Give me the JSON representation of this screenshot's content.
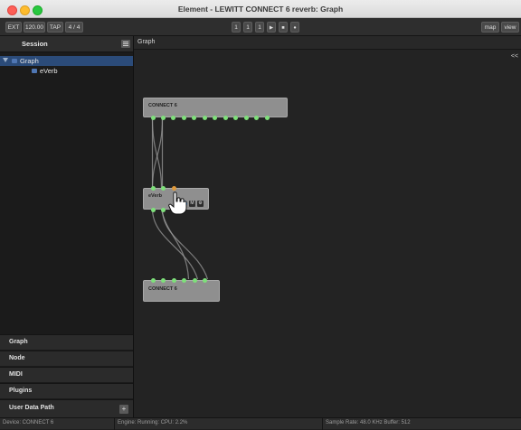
{
  "window": {
    "title": "Element - LEWITT CONNECT 6 reverb: Graph"
  },
  "toolbar": {
    "ext": "EXT",
    "tempo": "120.00",
    "tap": "TAP",
    "meter": "4 / 4",
    "transport": [
      "1",
      "1",
      "1",
      "▶",
      "■",
      "●"
    ],
    "map": "map",
    "view": "view"
  },
  "sidebar": {
    "session_title": "Session",
    "tree": [
      {
        "label": "Graph",
        "selected": true
      },
      {
        "label": "eVerb",
        "selected": false
      }
    ],
    "sections": [
      "Graph",
      "Node",
      "MIDI",
      "Plugins",
      "User Data Path"
    ],
    "add_symbol": "+"
  },
  "main": {
    "tab": "Graph",
    "toggle": "<<"
  },
  "graph": {
    "nodes": [
      {
        "name": "CONNECT 6",
        "outputs": 12,
        "inputs": 0
      },
      {
        "name": "eVerb",
        "inputs": 4,
        "outputs": 4,
        "buttons": [
          "⏻",
          "M",
          "⚙"
        ]
      },
      {
        "name": "CONNECT 6",
        "inputs": 6,
        "outputs": 0
      }
    ]
  },
  "status": {
    "device": "Device: CONNECT 6",
    "engine": "Engine: Running:  CPU: 2.2%",
    "audio": "Sample Rate: 48.0 KHz  Buffer: 512"
  },
  "colors": {
    "port": "#7ee07a",
    "accent": "#2b4b79",
    "midi_port": "#e09a3c"
  }
}
